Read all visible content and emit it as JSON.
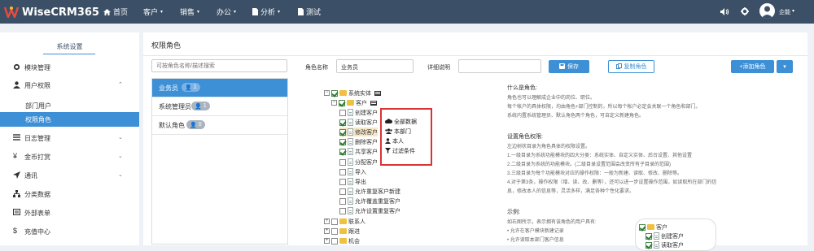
{
  "app": {
    "brand": "WiseCRM365",
    "user_name": "企能"
  },
  "nav": [
    {
      "label": "首页",
      "icon": "home-icon"
    },
    {
      "label": "客户",
      "icon": "",
      "dropdown": true
    },
    {
      "label": "销售",
      "icon": "",
      "dropdown": true
    },
    {
      "label": "办公",
      "icon": "",
      "dropdown": true
    },
    {
      "label": "分析",
      "icon": "file-icon",
      "dropdown": true
    },
    {
      "label": "测试",
      "icon": "file-icon"
    }
  ],
  "sidebar": {
    "title": "系统设置",
    "items": [
      {
        "label": "模块管理",
        "icon": "gear-icon"
      },
      {
        "label": "用户权限",
        "icon": "user-icon",
        "expanded": true
      },
      {
        "label": "部门用户",
        "sub": true
      },
      {
        "label": "权限角色",
        "sub": true,
        "active": true
      },
      {
        "label": "日志管理",
        "icon": "list-icon"
      },
      {
        "label": "金币打赏",
        "icon": "yen-icon"
      },
      {
        "label": "通讯",
        "icon": "send-icon"
      },
      {
        "label": "分类数据",
        "icon": "sitemap-icon"
      },
      {
        "label": "外部表单",
        "icon": "form-icon"
      },
      {
        "label": "充值中心",
        "icon": "dollar-icon"
      }
    ]
  },
  "page": {
    "title": "权限角色",
    "search_placeholder": "可按角色名称/描述搜索",
    "roles": [
      {
        "name": "业务员",
        "count": "1",
        "selected": true
      },
      {
        "name": "系统管理员",
        "count": "1"
      },
      {
        "name": "默认角色",
        "count": "0"
      }
    ],
    "role_name_label": "角色名称",
    "role_name_value": "业务员",
    "detail_label": "详细说明",
    "detail_value": "",
    "save_label": "保存",
    "copy_label": "复制角色",
    "add_label": "+添加角色"
  },
  "tree": [
    {
      "label": "系统实体",
      "type": "folder",
      "checked": true,
      "level": 0,
      "expander": "−",
      "table_icon": true
    },
    {
      "label": "客户",
      "type": "folder",
      "checked": true,
      "level": 1,
      "expander": "−",
      "table_icon": true
    },
    {
      "label": "创建客户",
      "type": "doc",
      "checked": false,
      "level": 2
    },
    {
      "label": "读取客户",
      "type": "doc",
      "checked": true,
      "level": 2
    },
    {
      "label": "修改客户",
      "type": "doc",
      "checked": true,
      "level": 2
    },
    {
      "label": "删除客户",
      "type": "doc",
      "checked": true,
      "level": 2
    },
    {
      "label": "共享客户",
      "type": "doc",
      "checked": true,
      "level": 2
    },
    {
      "label": "分配客户",
      "type": "doc",
      "checked": false,
      "level": 2
    },
    {
      "label": "导入",
      "type": "doc",
      "checked": false,
      "level": 2
    },
    {
      "label": "导出",
      "type": "doc",
      "checked": false,
      "level": 2
    },
    {
      "label": "允许重复客户新建",
      "type": "doc",
      "checked": false,
      "level": 2
    },
    {
      "label": "允许覆盖重复客户",
      "type": "doc",
      "checked": false,
      "level": 2
    },
    {
      "label": "允许设置重复客户",
      "type": "doc",
      "checked": false,
      "level": 2
    },
    {
      "label": "联系人",
      "type": "folder",
      "checked": false,
      "level": 1,
      "expander": "+"
    },
    {
      "label": "跟进",
      "type": "folder",
      "checked": false,
      "level": 1,
      "expander": "+"
    },
    {
      "label": "机会",
      "type": "folder",
      "checked": false,
      "level": 1,
      "expander": "+"
    }
  ],
  "scope_menu": [
    {
      "label": "全部数据",
      "icon": "cloud-icon"
    },
    {
      "label": "本部门",
      "icon": "group-icon"
    },
    {
      "label": "本人",
      "icon": "person-icon"
    },
    {
      "label": "过滤条件",
      "icon": "filter-icon"
    }
  ],
  "help": {
    "lines": [
      {
        "text": "什么是角色:",
        "heading": true
      },
      {
        "text": "角色也可以理解成企业中的岗位、职位。"
      },
      {
        "text": "每个帐户的具体权限，均由角色+部门控制的，所以每个帐户必定会关联一个角色和部门。"
      },
      {
        "text": "系统内置系统管理员、默认角色两个角色，可自定义新建角色。"
      },
      {
        "text": "设置角色权限:",
        "heading": true
      },
      {
        "text": "左边树状目录为角色具体的权限设置。"
      },
      {
        "text": "1.一级目录为系统功能模块的四大分类：系统实体、自定义实体、后台设置、其他设置"
      },
      {
        "text": "2.二级目录为系统的功能模块。(二级目录设置范围会改变所有子目录的范围)"
      },
      {
        "text": "3.三级目录为每个功能模块对应的操作权限：一般为新建、读取、修改、删除等。"
      },
      {
        "text": "4.对于第3条，操作权限（增、读、改、删等），还可以进一步设置操作范围，如读取所在部门的信"
      },
      {
        "text": "息，修改本人的信息等，灵活多样，满足各种个性化要求。"
      },
      {
        "text": "示例:",
        "heading": true
      },
      {
        "text": "如右图所示，表示拥有该角色的用户具有:"
      },
      {
        "text": "• 允许在客户模块新建记录"
      },
      {
        "text": "• 允许读取本部门客户信息"
      }
    ],
    "mini_labels": [
      "客户",
      "创建客户",
      "读取客户"
    ]
  }
}
